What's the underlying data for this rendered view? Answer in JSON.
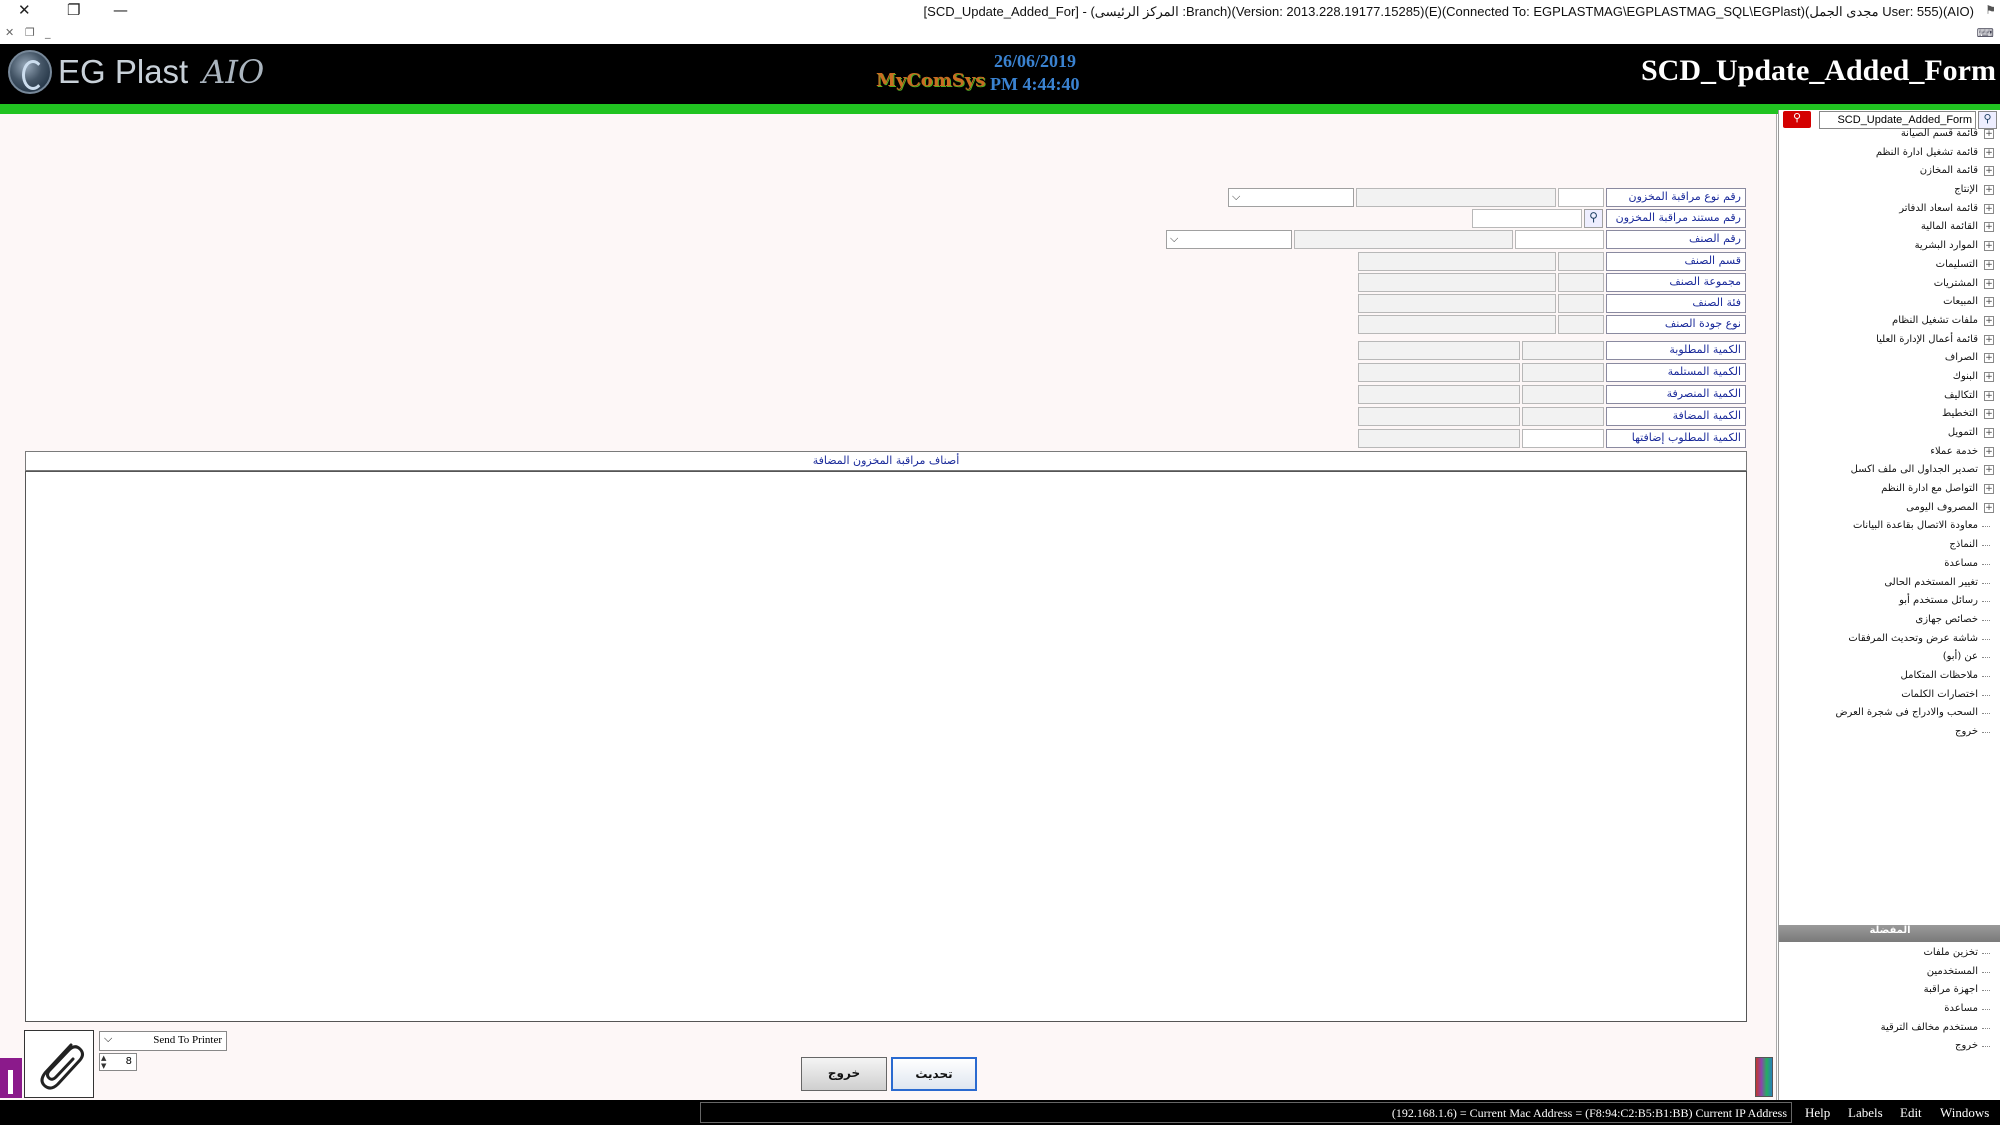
{
  "window": {
    "title": "[SCD_Update_Added_For] - (المركز الرئيسى :Branch)(Version: 2013.228.19177.15285)(E)(Connected To: EGPLASTMAG\\EGPLASTMAG_SQL\\EGPlast)(مجدى الجمل User: 555)(AIO)",
    "close_glyph": "✕",
    "restore_glyph": "❐",
    "minimize_glyph": "—"
  },
  "header": {
    "logo_text": "EG Plast",
    "logo_suffix": "AIO",
    "brand": "MyComSys",
    "date": "26/06/2019",
    "time": "PM 4:44:40",
    "form_title": "SCD_Update_Added_Form"
  },
  "form": {
    "fields": {
      "inventory_type_no": "رقم نوع مراقبة المخزون",
      "inventory_doc_no": "رقم مستند مراقبة المخزون",
      "item_no": "رقم الصنف",
      "item_section": "قسم الصنف",
      "item_group": "مجموعة الصنف",
      "item_category": "فئة الصنف",
      "item_quality_type": "نوع جودة الصنف",
      "qty_required": "الكمية المطلوبة",
      "qty_received": "الكمية المستلمة",
      "qty_dispensed": "الكمية المنصرفة",
      "qty_added": "الكمية المضافة",
      "qty_to_add": "الكمية المطلوب إضافتها"
    },
    "grid_title": "أصناف مراقبة المخزون المضافة",
    "printer_option": "Send To Printer",
    "copies": "8",
    "buttons": {
      "exit": "خروج",
      "update": "تحديث"
    }
  },
  "sidebar": {
    "search_value": "SCD_Update_Added_Form",
    "menu": [
      {
        "label": "قائمة قسم الصيانة",
        "expandable": true
      },
      {
        "label": "قائمة تشغيل ادارة النظم",
        "expandable": true
      },
      {
        "label": "قائمة المخازن",
        "expandable": true
      },
      {
        "label": "الإنتاج",
        "expandable": true
      },
      {
        "label": "قائمة اسعاد الدفاتر",
        "expandable": true
      },
      {
        "label": "القائمة المالية",
        "expandable": true
      },
      {
        "label": "الموارد البشرية",
        "expandable": true
      },
      {
        "label": "التسليمات",
        "expandable": true
      },
      {
        "label": "المشتريات",
        "expandable": true
      },
      {
        "label": "المبيعات",
        "expandable": true
      },
      {
        "label": "ملفات تشغيل النظام",
        "expandable": true
      },
      {
        "label": "قائمة أعمال الإدارة العليا",
        "expandable": true
      },
      {
        "label": "الصراف",
        "expandable": true
      },
      {
        "label": "البنوك",
        "expandable": true
      },
      {
        "label": "التكاليف",
        "expandable": true
      },
      {
        "label": "التخطيط",
        "expandable": true
      },
      {
        "label": "التمويل",
        "expandable": true
      },
      {
        "label": "خدمة عملاء",
        "expandable": true
      },
      {
        "label": "تصدير الجداول الى ملف اكسل",
        "expandable": true
      },
      {
        "label": "التواصل مع ادارة النظم",
        "expandable": true
      },
      {
        "label": "المصروف اليومى",
        "expandable": true
      },
      {
        "label": "معاودة الاتصال بقاعدة البيانات",
        "expandable": false
      },
      {
        "label": "النماذج",
        "expandable": false
      },
      {
        "label": "مساعدة",
        "expandable": false
      },
      {
        "label": "تغيير المستخدم الحالى",
        "expandable": false
      },
      {
        "label": "رسائل مستخدم أبو",
        "expandable": false
      },
      {
        "label": "خصائص جهازى",
        "expandable": false
      },
      {
        "label": "شاشة عرض وتحديث المرفقات",
        "expandable": false
      },
      {
        "label": "عن (أبو)",
        "expandable": false
      },
      {
        "label": "ملاحظات المتكامل",
        "expandable": false
      },
      {
        "label": "اختصارات الكلمات",
        "expandable": false
      },
      {
        "label": "السحب والادراج فى شجرة العرض",
        "expandable": false
      },
      {
        "label": "خروج",
        "expandable": false
      }
    ],
    "favorites_title": "المفضلة",
    "favorites": [
      {
        "label": "تخزين ملفات"
      },
      {
        "label": "المستخدمين"
      },
      {
        "label": "اجهزة مراقبة"
      },
      {
        "label": "مساعدة"
      },
      {
        "label": "مستخدم مخالف الترقية"
      },
      {
        "label": "خروج"
      }
    ]
  },
  "statusbar": {
    "info": "(192.168.1.6) = Current Mac Address = (F8:94:C2:B5:B1:BB) Current IP Address",
    "menu": {
      "help": "Help",
      "labels": "Labels",
      "edit": "Edit",
      "windows": "Windows"
    }
  }
}
